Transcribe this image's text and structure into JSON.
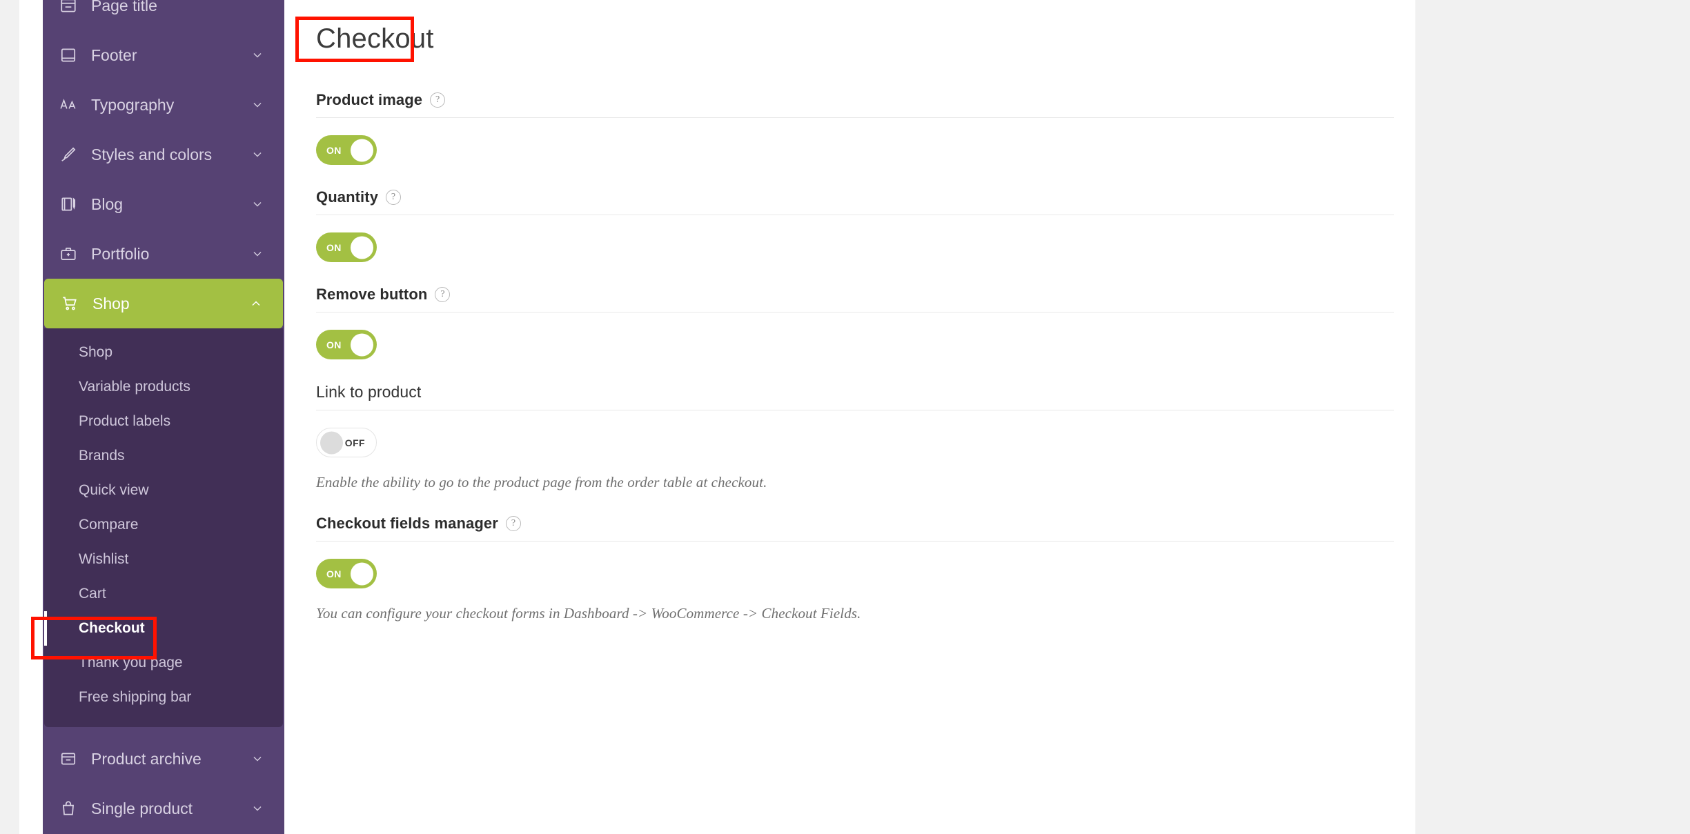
{
  "theme": {
    "sidebar_bg": "#564273",
    "submenu_bg": "#412f56",
    "accent_green": "#a3c043",
    "annotation_red": "#ff1200",
    "content_bg": "#ffffff",
    "canvas_bg": "#f1f1f1"
  },
  "sidebar": {
    "items": [
      {
        "label": "Page title",
        "icon": "page-title-icon",
        "expandable": false,
        "active": false
      },
      {
        "label": "Footer",
        "icon": "footer-icon",
        "expandable": true,
        "active": false
      },
      {
        "label": "Typography",
        "icon": "typography-icon",
        "expandable": true,
        "active": false
      },
      {
        "label": "Styles and colors",
        "icon": "brush-icon",
        "expandable": true,
        "active": false
      },
      {
        "label": "Blog",
        "icon": "blog-icon",
        "expandable": true,
        "active": false
      },
      {
        "label": "Portfolio",
        "icon": "briefcase-icon",
        "expandable": true,
        "active": false
      },
      {
        "label": "Shop",
        "icon": "cart-icon",
        "expandable": true,
        "active": true
      }
    ],
    "shop_submenu": [
      {
        "label": "Shop",
        "current": false
      },
      {
        "label": "Variable products",
        "current": false
      },
      {
        "label": "Product labels",
        "current": false
      },
      {
        "label": "Brands",
        "current": false
      },
      {
        "label": "Quick view",
        "current": false
      },
      {
        "label": "Compare",
        "current": false
      },
      {
        "label": "Wishlist",
        "current": false
      },
      {
        "label": "Cart",
        "current": false
      },
      {
        "label": "Checkout",
        "current": true
      },
      {
        "label": "Thank you page",
        "current": false
      },
      {
        "label": "Free shipping bar",
        "current": false
      }
    ],
    "items_after": [
      {
        "label": "Product archive",
        "icon": "archive-icon",
        "expandable": true
      },
      {
        "label": "Single product",
        "icon": "bag-icon",
        "expandable": true
      }
    ]
  },
  "main": {
    "title": "Checkout",
    "fields": [
      {
        "label": "Product image",
        "has_help": true,
        "help_glyph": "?",
        "toggle_state": "ON",
        "description": ""
      },
      {
        "label": "Quantity",
        "has_help": true,
        "help_glyph": "?",
        "toggle_state": "ON",
        "description": ""
      },
      {
        "label": "Remove button",
        "has_help": true,
        "help_glyph": "?",
        "toggle_state": "ON",
        "description": ""
      },
      {
        "label": "Link to product",
        "has_help": false,
        "help_glyph": "",
        "toggle_state": "OFF",
        "description": "Enable the ability to go to the product page from the order table at checkout."
      },
      {
        "label": "Checkout fields manager",
        "has_help": true,
        "help_glyph": "?",
        "toggle_state": "ON",
        "description": "You can configure your checkout forms in Dashboard -> WooCommerce -> Checkout Fields."
      }
    ]
  },
  "annotations": [
    {
      "name": "sidebar-checkout-highlight",
      "target": "Checkout"
    },
    {
      "name": "page-title-highlight",
      "target": "Checkout"
    }
  ]
}
